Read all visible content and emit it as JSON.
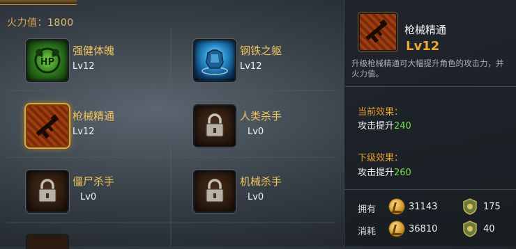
{
  "header": {
    "firepower_label": "火力值：",
    "firepower_value": "1800"
  },
  "skills": [
    {
      "name": "强健体魄",
      "level": "Lv12",
      "icon": "hp-muscle-icon"
    },
    {
      "name": "钢铁之躯",
      "level": "Lv12",
      "icon": "steel-armor-icon"
    },
    {
      "name": "枪械精通",
      "level": "Lv12",
      "icon": "gun-mastery-icon",
      "selected": true
    },
    {
      "name": "人类杀手",
      "level": "Lv0",
      "icon": "lock-icon"
    },
    {
      "name": "僵尸杀手",
      "level": "Lv0",
      "icon": "lock-icon"
    },
    {
      "name": "机械杀手",
      "level": "Lv0",
      "icon": "lock-icon"
    }
  ],
  "hp_badge": "HP",
  "detail": {
    "title": "枪械精通",
    "level": "Lv12",
    "description": "升级枪械精通可大幅提升角色的攻击力，并",
    "description_2": "火力值。",
    "current_effect_label": "当前效果：",
    "current_effect_text": "攻击提升",
    "current_effect_value": "240",
    "next_effect_label": "下级效果：",
    "next_effect_text": "攻击提升",
    "next_effect_value": "260"
  },
  "resources": {
    "owned_label": "拥有",
    "owned_coins": "31143",
    "owned_medals": "175",
    "cost_label": "消耗",
    "cost_coins": "36810",
    "cost_medals": "40"
  },
  "colors": {
    "gold_text": "#f0c560",
    "level_orange": "#f0a830",
    "green_value": "#6fe04a",
    "effect_header": "#e89d33"
  }
}
